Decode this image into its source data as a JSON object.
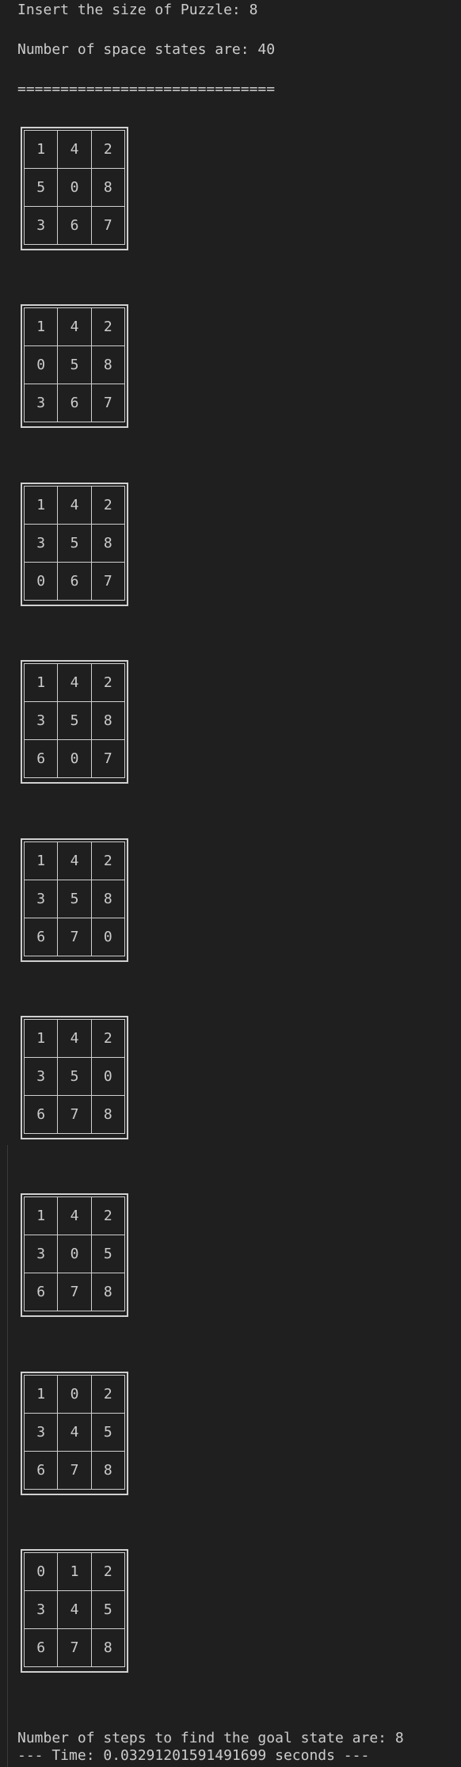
{
  "output": {
    "prompt_line": "Insert the size of Puzzle: 8",
    "states_line": "Number of space states are: 40",
    "separator": "==============================",
    "puzzles": [
      [
        [
          "1",
          "4",
          "2"
        ],
        [
          "5",
          "0",
          "8"
        ],
        [
          "3",
          "6",
          "7"
        ]
      ],
      [
        [
          "1",
          "4",
          "2"
        ],
        [
          "0",
          "5",
          "8"
        ],
        [
          "3",
          "6",
          "7"
        ]
      ],
      [
        [
          "1",
          "4",
          "2"
        ],
        [
          "3",
          "5",
          "8"
        ],
        [
          "0",
          "6",
          "7"
        ]
      ],
      [
        [
          "1",
          "4",
          "2"
        ],
        [
          "3",
          "5",
          "8"
        ],
        [
          "6",
          "0",
          "7"
        ]
      ],
      [
        [
          "1",
          "4",
          "2"
        ],
        [
          "3",
          "5",
          "8"
        ],
        [
          "6",
          "7",
          "0"
        ]
      ],
      [
        [
          "1",
          "4",
          "2"
        ],
        [
          "3",
          "5",
          "0"
        ],
        [
          "6",
          "7",
          "8"
        ]
      ],
      [
        [
          "1",
          "4",
          "2"
        ],
        [
          "3",
          "0",
          "5"
        ],
        [
          "6",
          "7",
          "8"
        ]
      ],
      [
        [
          "1",
          "0",
          "2"
        ],
        [
          "3",
          "4",
          "5"
        ],
        [
          "6",
          "7",
          "8"
        ]
      ],
      [
        [
          "0",
          "1",
          "2"
        ],
        [
          "3",
          "4",
          "5"
        ],
        [
          "6",
          "7",
          "8"
        ]
      ]
    ],
    "steps_line": "Number of steps to find the goal state are: 8",
    "time_line": "--- Time: 0.03291201591491699 seconds ---"
  }
}
